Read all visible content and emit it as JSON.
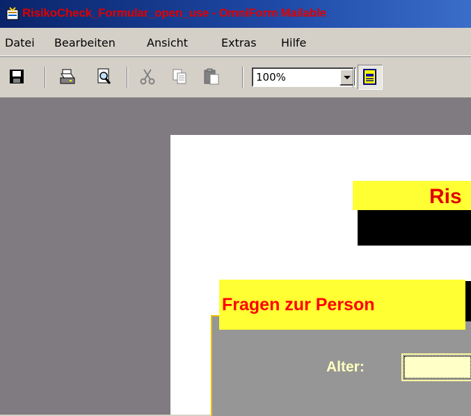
{
  "window": {
    "title": "RisikoCheck_Formular_open_use - OmniForm Mailable"
  },
  "menu": {
    "items": [
      "Datei",
      "Bearbeiten",
      "Ansicht",
      "Extras",
      "Hilfe"
    ]
  },
  "toolbar": {
    "zoom_value": "100%",
    "icons": [
      "save-icon",
      "print-icon",
      "print-preview-icon",
      "cut-icon",
      "copy-icon",
      "paste-icon",
      "form-view-icon"
    ]
  },
  "document": {
    "title": "Ris",
    "section_heading": "Fragen zur Person",
    "fields": {
      "age_label": "Alter:",
      "age_value": ""
    }
  },
  "colors": {
    "titlebar": "#0a246a",
    "workspace": "#807b80",
    "heading_yellow": "#ffff33",
    "heading_red": "#e00000",
    "panel_gray": "#969696"
  }
}
